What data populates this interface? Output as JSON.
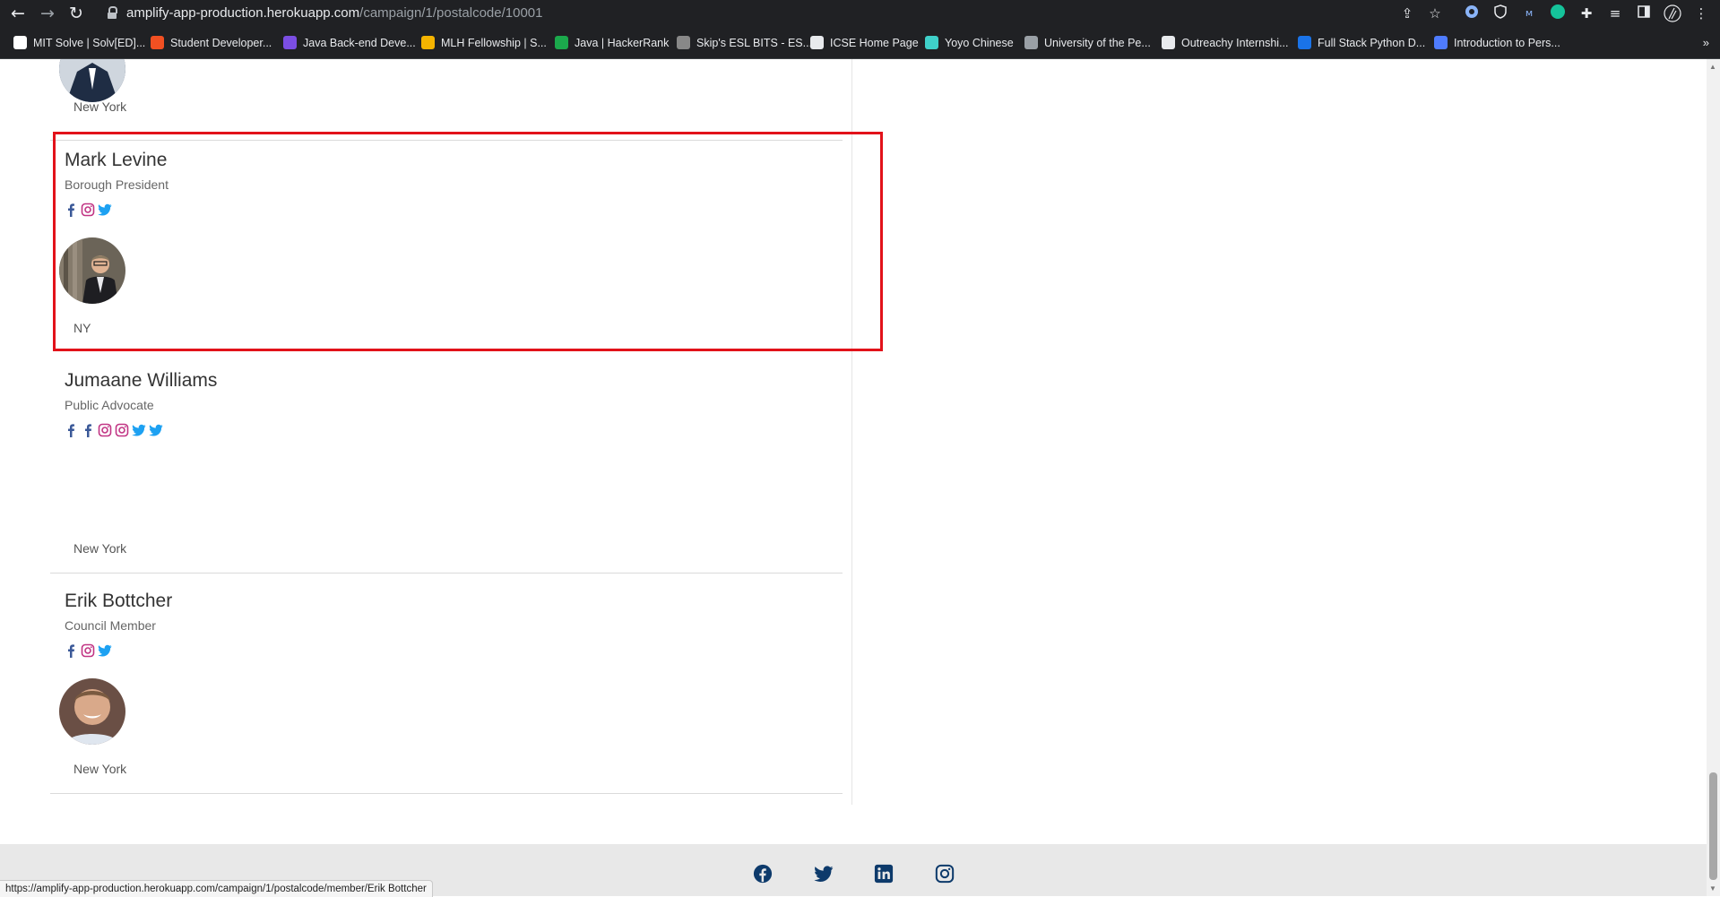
{
  "browser": {
    "url_host": "amplify-app-production.herokuapp.com",
    "url_path": "/campaign/1/postalcode/10001",
    "status_url": "https://amplify-app-production.herokuapp.com/campaign/1/postalcode/member/Erik Bottcher"
  },
  "bookmarks": [
    {
      "label": "MIT Solve | Solv[ED]...",
      "color": "#ffffff"
    },
    {
      "label": "Student Developer...",
      "color": "#f25022"
    },
    {
      "label": "Java Back-end Deve...",
      "color": "#7b4ee3"
    },
    {
      "label": "MLH Fellowship | S...",
      "color": "#f5b400"
    },
    {
      "label": "Java | HackerRank",
      "color": "#1ba94c"
    },
    {
      "label": "Skip's ESL BITS - ES...",
      "color": "#888888"
    },
    {
      "label": "ICSE Home Page",
      "color": "#e8eaed"
    },
    {
      "label": "Yoyo Chinese",
      "color": "#3fd0c9"
    },
    {
      "label": "University of the Pe...",
      "color": "#9aa0a6"
    },
    {
      "label": "Outreachy Internshi...",
      "color": "#e8eaed"
    },
    {
      "label": "Full Stack Python D...",
      "color": "#1a73e8"
    },
    {
      "label": "Introduction to Pers...",
      "color": "#4f7cff"
    }
  ],
  "members": [
    {
      "name": "",
      "role": "",
      "location": "New York"
    },
    {
      "name": "Mark Levine",
      "role": "Borough President",
      "location": "NY"
    },
    {
      "name": "Jumaane Williams",
      "role": "Public Advocate",
      "location": "New York"
    },
    {
      "name": "Erik Bottcher",
      "role": "Council Member",
      "location": "New York"
    }
  ],
  "colors": {
    "facebook": "#3b5998",
    "instagram": "#c13584",
    "twitter": "#1da1f2",
    "highlight": "#e2121a",
    "footer_icon": "#0d3a6b"
  },
  "footer_icons": [
    "facebook-icon",
    "twitter-icon",
    "linkedin-icon",
    "instagram-icon"
  ]
}
